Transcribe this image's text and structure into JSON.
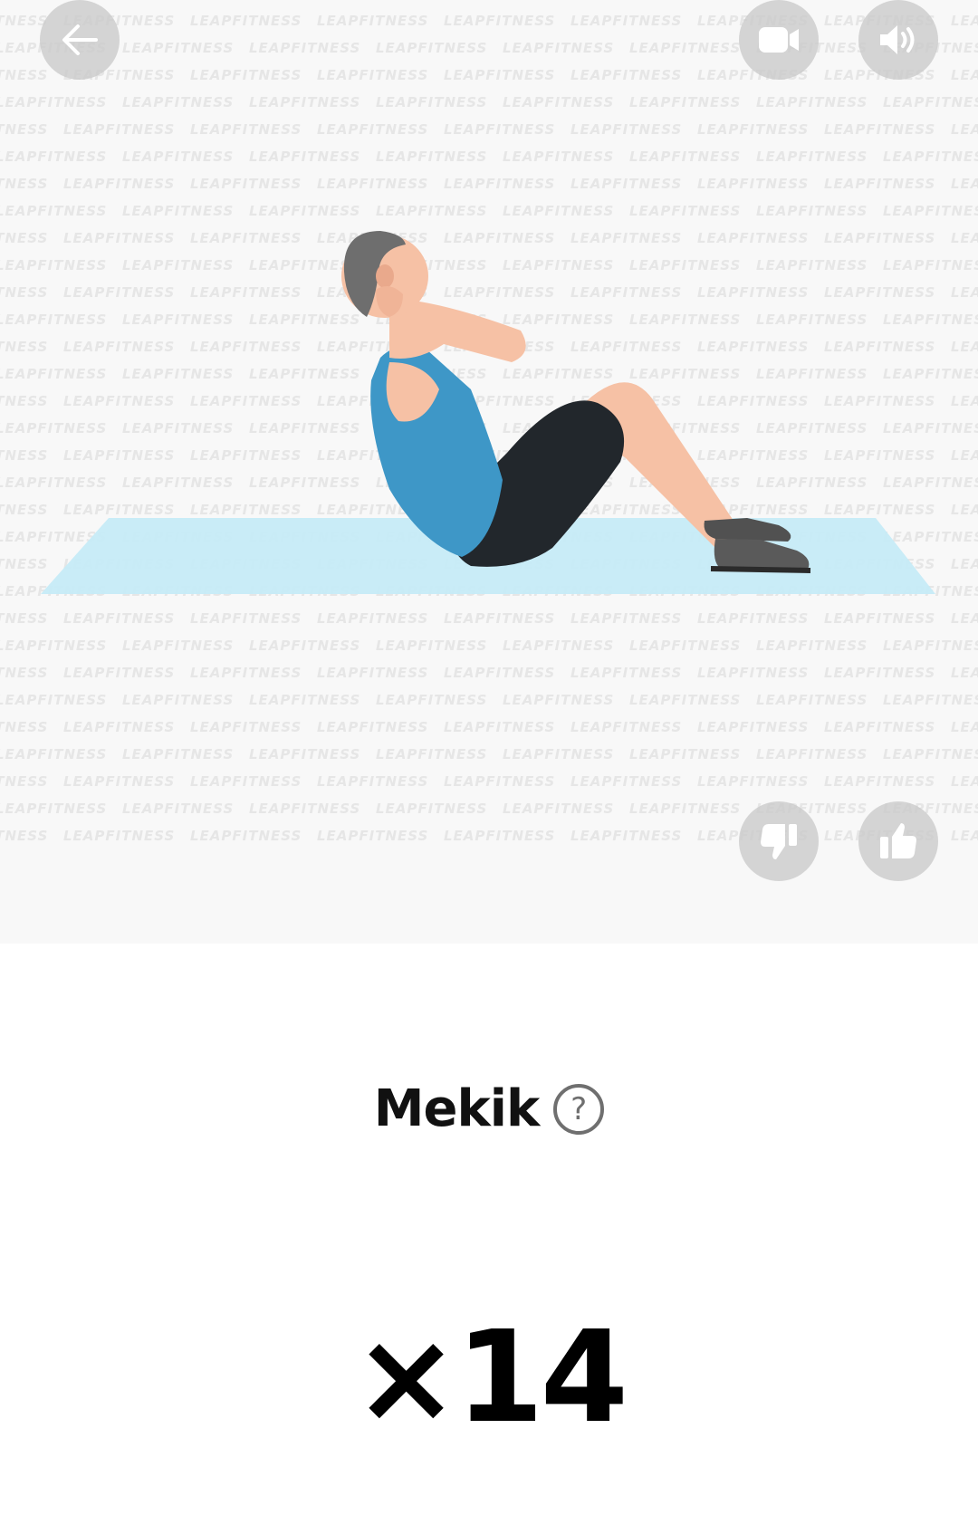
{
  "watermark": {
    "text": "LEAPFITNESS"
  },
  "toolbar": {
    "back_icon": "arrow-left-icon",
    "video_icon": "video-camera-icon",
    "sound_icon": "speaker-icon"
  },
  "feedback": {
    "dislike_icon": "thumbs-down-icon",
    "like_icon": "thumbs-up-icon"
  },
  "exercise": {
    "name": "Mekik",
    "help_symbol": "?",
    "reps": "×14"
  },
  "colors": {
    "illustration_bg": "#f8f8f8",
    "mat": "#c6ebf7",
    "shirt": "#3e97c7",
    "shorts": "#22272c",
    "skin": "#f6c1a5",
    "hair": "#6e6e6e",
    "button_bg": "#cfcfcf"
  }
}
